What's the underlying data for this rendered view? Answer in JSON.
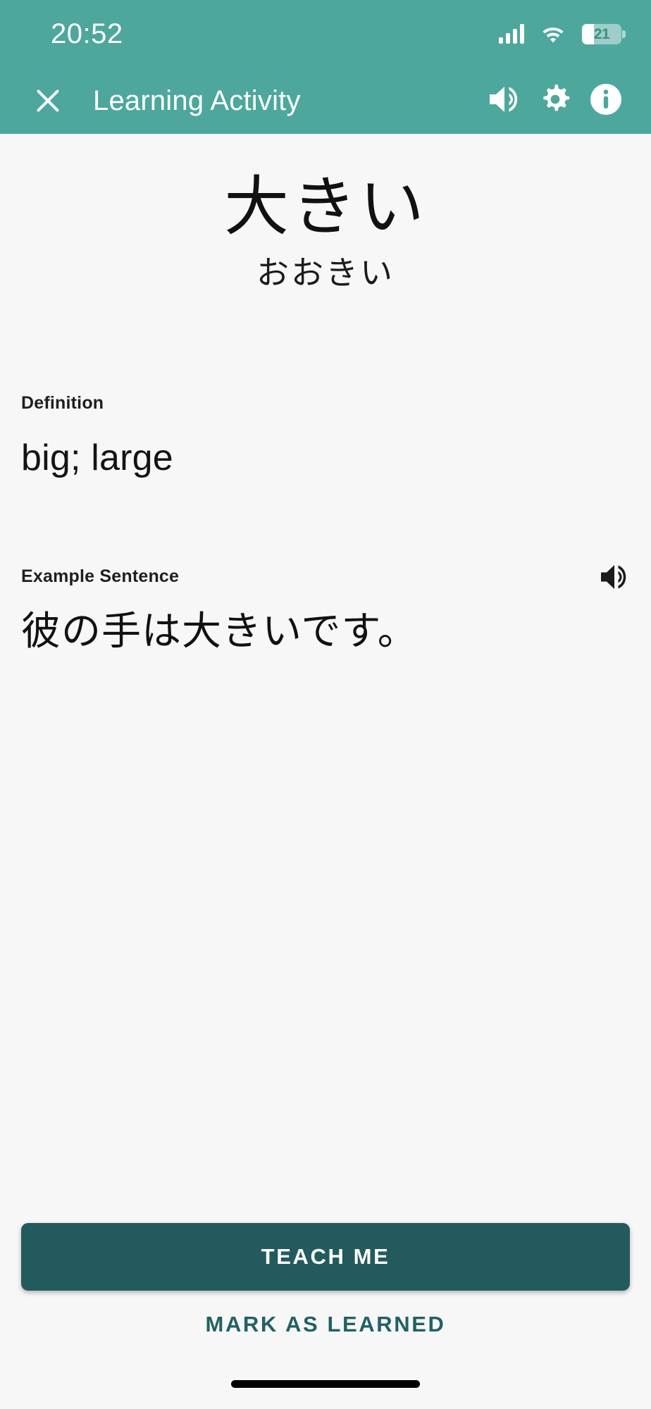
{
  "status_bar": {
    "time": "20:52",
    "battery_level": "21",
    "signal_icon": "cellular-signal-icon",
    "wifi_icon": "wifi-icon",
    "battery_icon": "battery-icon"
  },
  "app_bar": {
    "title": "Learning Activity",
    "close_icon": "close-icon",
    "volume_icon": "volume-up-icon",
    "settings_icon": "gear-icon",
    "info_icon": "info-icon",
    "background_color": "#4ea79c"
  },
  "card": {
    "word": "大きい",
    "reading": "おおきい",
    "definition_label": "Definition",
    "definition_text": "big; large",
    "example_label": "Example Sentence",
    "example_audio_icon": "volume-up-icon",
    "example_sentence": "彼の手は大きいです。"
  },
  "footer": {
    "primary_button_label": "TEACH ME",
    "primary_button_color": "#235a5d",
    "secondary_button_label": "MARK AS LEARNED",
    "secondary_button_color": "#236163"
  }
}
